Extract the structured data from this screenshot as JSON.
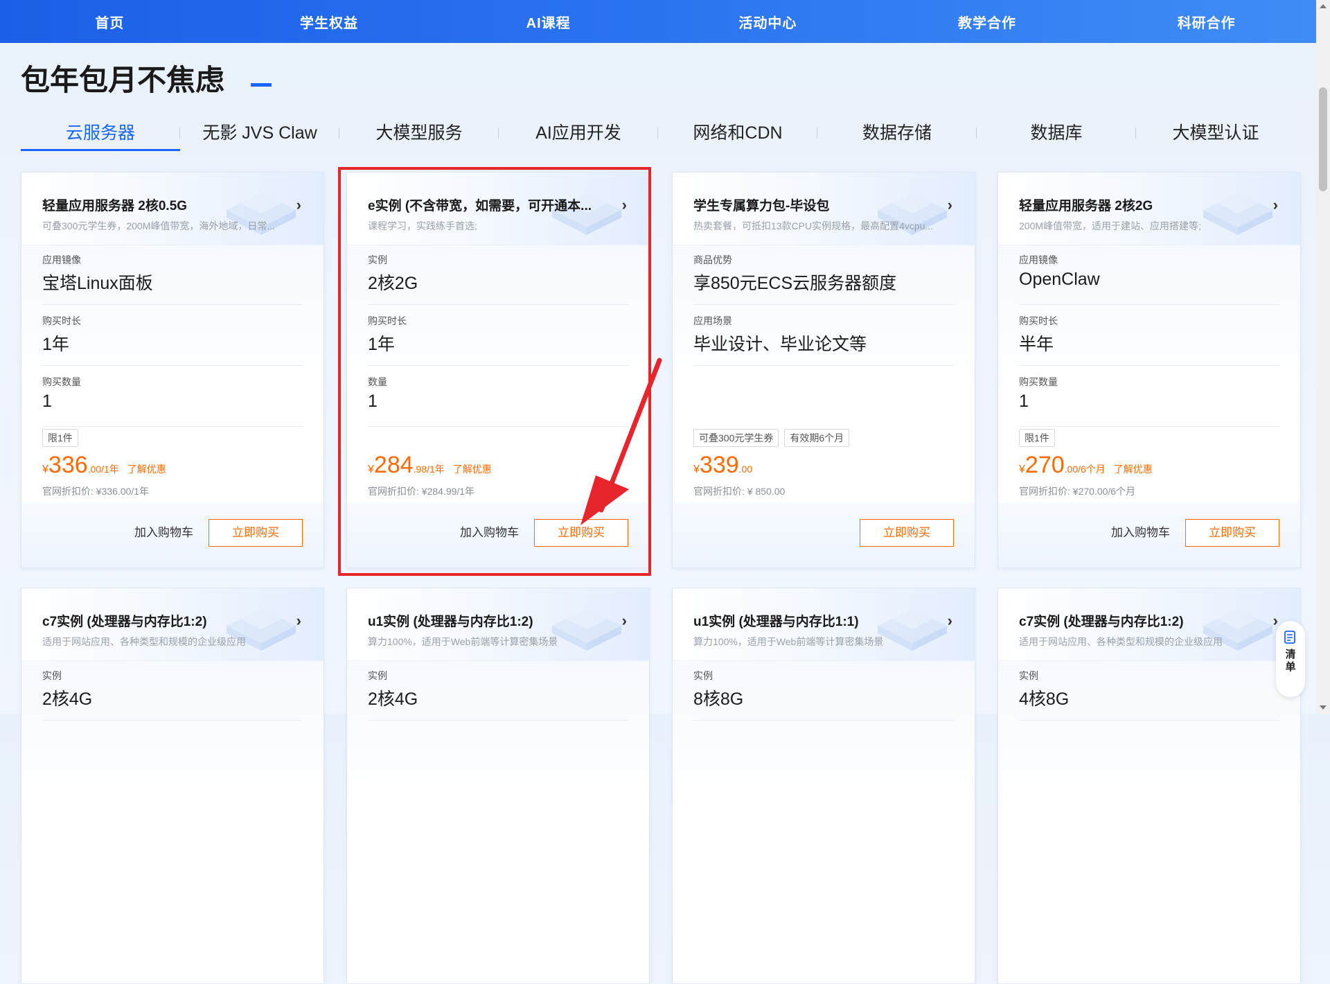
{
  "nav": [
    "首页",
    "学生权益",
    "AI课程",
    "活动中心",
    "教学合作",
    "科研合作"
  ],
  "title": "包年包月不焦虑",
  "tabs": [
    "云服务器",
    "无影 JVS Claw",
    "大模型服务",
    "AI应用开发",
    "网络和CDN",
    "数据存储",
    "数据库",
    "大模型认证"
  ],
  "cards": [
    {
      "name": "轻量应用服务器 2核0.5G",
      "desc": "可叠300元学生券，200M峰值带宽，海外地域，日常...",
      "specs": [
        {
          "k": "应用镜像",
          "v": "宝塔Linux面板"
        },
        {
          "k": "购买时长",
          "v": "1年"
        },
        {
          "k": "购买数量",
          "v": "1"
        }
      ],
      "badges": [
        "限1件"
      ],
      "price": {
        "cur": "¥",
        "int": "336",
        "dec": ".00",
        "unit": "/1年",
        "more": "了解优惠"
      },
      "orig": "官网折扣价: ¥336.00/1年",
      "cart": "加入购物车",
      "buy": "立即购买"
    },
    {
      "name": "e实例 (不含带宽，如需要，可开通本...",
      "desc": "课程学习，实践练手首选;",
      "specs": [
        {
          "k": "实例",
          "v": "2核2G"
        },
        {
          "k": "购买时长",
          "v": "1年"
        },
        {
          "k": "数量",
          "v": "1"
        }
      ],
      "badges": [],
      "price": {
        "cur": "¥",
        "int": "284",
        "dec": ".98",
        "unit": "/1年",
        "more": "了解优惠"
      },
      "orig": "官网折扣价: ¥284.99/1年",
      "cart": "加入购物车",
      "buy": "立即购买"
    },
    {
      "name": "学生专属算力包-毕设包",
      "desc": "热卖套餐，可抵扣13款CPU实例规格，最高配置4vcpu...",
      "specs": [
        {
          "k": "商品优势",
          "v": "享850元ECS云服务器额度"
        },
        {
          "k": "应用场景",
          "v": "毕业设计、毕业论文等"
        }
      ],
      "badges": [
        "可叠300元学生券",
        "有效期6个月"
      ],
      "price": {
        "cur": "¥",
        "int": "339",
        "dec": ".00",
        "unit": "",
        "more": ""
      },
      "orig": "官网折扣价: ¥ 850.00",
      "cart": "",
      "buy": "立即购买"
    },
    {
      "name": "轻量应用服务器 2核2G",
      "desc": "200M峰值带宽，适用于建站、应用搭建等;",
      "specs": [
        {
          "k": "应用镜像",
          "v": "OpenClaw"
        },
        {
          "k": "购买时长",
          "v": "半年"
        },
        {
          "k": "购买数量",
          "v": "1"
        }
      ],
      "badges": [
        "限1件"
      ],
      "price": {
        "cur": "¥",
        "int": "270",
        "dec": ".00",
        "unit": "/6个月",
        "more": "了解优惠"
      },
      "orig": "官网折扣价: ¥270.00/6个月",
      "cart": "加入购物车",
      "buy": "立即购买"
    },
    {
      "name": "c7实例 (处理器与内存比1:2)",
      "desc": "适用于网站应用、各种类型和规模的企业级应用",
      "specs": [
        {
          "k": "实例",
          "v": "2核4G"
        }
      ],
      "badges": [],
      "price": null,
      "orig": "",
      "cart": "",
      "buy": ""
    },
    {
      "name": "u1实例 (处理器与内存比1:2)",
      "desc": "算力100%，适用于Web前端等计算密集场景",
      "specs": [
        {
          "k": "实例",
          "v": "2核4G"
        }
      ],
      "badges": [],
      "price": null,
      "orig": "",
      "cart": "",
      "buy": ""
    },
    {
      "name": "u1实例 (处理器与内存比1:1)",
      "desc": "算力100%，适用于Web前端等计算密集场景",
      "specs": [
        {
          "k": "实例",
          "v": "8核8G"
        }
      ],
      "badges": [],
      "price": null,
      "orig": "",
      "cart": "",
      "buy": ""
    },
    {
      "name": "c7实例 (处理器与内存比1:2)",
      "desc": "适用于网站应用、各种类型和规模的企业级应用",
      "specs": [
        {
          "k": "实例",
          "v": "4核8G"
        }
      ],
      "badges": [],
      "price": null,
      "orig": "",
      "cart": "",
      "buy": ""
    }
  ],
  "float_list": {
    "line1": "清",
    "line2": "单"
  },
  "colors": {
    "nav": "#2b74f0",
    "accent": "#1966ff",
    "price": "#ff6a00",
    "highlight": "#e8242c"
  }
}
